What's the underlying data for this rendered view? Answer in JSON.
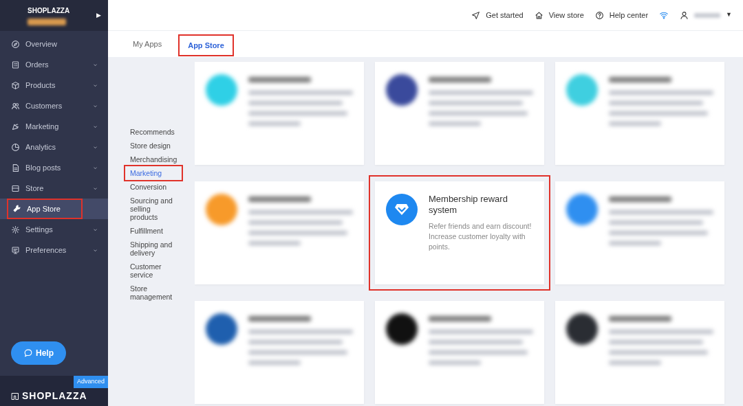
{
  "sidebar": {
    "brand": "SHOPLAZZA",
    "collapse_glyph": "▶",
    "items": [
      {
        "label": "Overview",
        "expandable": false,
        "selected": false,
        "highlighted": false
      },
      {
        "label": "Orders",
        "expandable": true,
        "selected": false,
        "highlighted": false
      },
      {
        "label": "Products",
        "expandable": true,
        "selected": false,
        "highlighted": false
      },
      {
        "label": "Customers",
        "expandable": true,
        "selected": false,
        "highlighted": false
      },
      {
        "label": "Marketing",
        "expandable": true,
        "selected": false,
        "highlighted": false
      },
      {
        "label": "Analytics",
        "expandable": true,
        "selected": false,
        "highlighted": false
      },
      {
        "label": "Blog posts",
        "expandable": true,
        "selected": false,
        "highlighted": false
      },
      {
        "label": "Store",
        "expandable": true,
        "selected": false,
        "highlighted": false
      },
      {
        "label": "App Store",
        "expandable": false,
        "selected": true,
        "highlighted": true
      },
      {
        "label": "Settings",
        "expandable": true,
        "selected": false,
        "highlighted": false
      },
      {
        "label": "Preferences",
        "expandable": true,
        "selected": false,
        "highlighted": false
      }
    ],
    "help_button": "Help",
    "plan_badge": "Advanced",
    "footer_logo": "SHOPLAZZA"
  },
  "header": {
    "links": [
      "Get started",
      "View store",
      "Help center"
    ],
    "user_caret": "▼"
  },
  "tabs": [
    {
      "label": "My Apps",
      "selected": false,
      "highlighted": false
    },
    {
      "label": "App Store",
      "selected": true,
      "highlighted": true
    }
  ],
  "categories": [
    {
      "label": "Recommends",
      "selected": false,
      "highlighted": false
    },
    {
      "label": "Store design",
      "selected": false,
      "highlighted": false
    },
    {
      "label": "Merchandising",
      "selected": false,
      "highlighted": false
    },
    {
      "label": "Marketing",
      "selected": true,
      "highlighted": true
    },
    {
      "label": "Conversion",
      "selected": false,
      "highlighted": false
    },
    {
      "label": "Sourcing and selling products",
      "selected": false,
      "highlighted": false
    },
    {
      "label": "Fulfillment",
      "selected": false,
      "highlighted": false
    },
    {
      "label": "Shipping and delivery",
      "selected": false,
      "highlighted": false
    },
    {
      "label": "Customer service",
      "selected": false,
      "highlighted": false
    },
    {
      "label": "Store management",
      "selected": false,
      "highlighted": false
    }
  ],
  "apps": [
    {
      "kind": "blurred",
      "color": "#2fd0e6"
    },
    {
      "kind": "blurred",
      "color": "#3a4a9c"
    },
    {
      "kind": "blurred",
      "color": "#3fcfe0"
    },
    {
      "kind": "blurred",
      "color": "#f79a2a"
    },
    {
      "kind": "app",
      "title": "Membership reward system",
      "description": "Refer friends and earn discount! Increase customer loyalty with points.",
      "color": "#1e88f0",
      "highlighted": true
    },
    {
      "kind": "blurred",
      "color": "#2f8ff0"
    },
    {
      "kind": "blurred",
      "color": "#1f5fae"
    },
    {
      "kind": "blurred",
      "color": "#111111"
    },
    {
      "kind": "blurred",
      "color": "#2a2d33"
    }
  ]
}
